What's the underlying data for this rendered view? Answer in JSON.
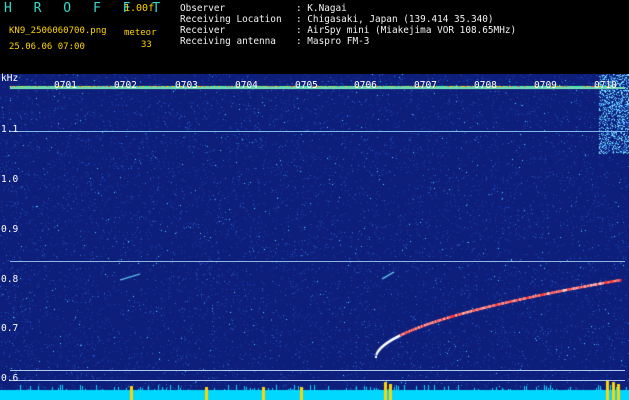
{
  "header": {
    "title": "H R O F F T",
    "version": "1.00f",
    "filename": "KN9_2506060700.png",
    "meteor_label": "meteor",
    "datetime": "25.06.06 07:00",
    "meteor_count": "33"
  },
  "info": [
    {
      "key": "Observer",
      "value": ": K.Nagai"
    },
    {
      "key": "Receiving Location",
      "value": ": Chigasaki, Japan (139.414 35.340)"
    },
    {
      "key": "Receiver",
      "value": ": AirSpy mini (Miakejima VOR 108.65MHz)"
    },
    {
      "key": "Receiving antenna",
      "value": ": Maspro FM-3"
    }
  ],
  "y_unit": "kHz",
  "y_ticks": [
    "1.1",
    "1.0",
    "0.9",
    "0.8",
    "0.7",
    "0.6"
  ],
  "time_labels": [
    "0701",
    "0702",
    "0703",
    "0704",
    "0705",
    "0706",
    "0707",
    "0708",
    "0709",
    "0710"
  ],
  "colors": {
    "background": "#0d1f7a",
    "trace": "#ff3a3a",
    "baseline": "#00d8ff",
    "marker": "#ffd400"
  }
}
